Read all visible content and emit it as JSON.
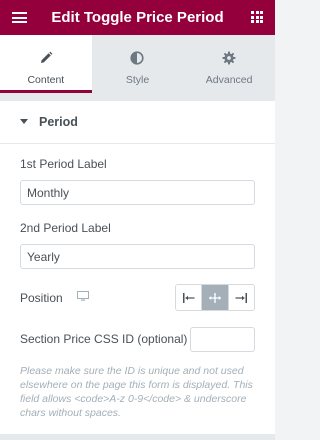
{
  "header": {
    "title": "Edit Toggle Price Period",
    "menu_icon": "hamburger-icon",
    "widgets_icon": "grid-icon",
    "background": "#93003c"
  },
  "tabs": [
    {
      "label": "Content",
      "icon": "pencil-icon",
      "active": true
    },
    {
      "label": "Style",
      "icon": "half-circle-icon",
      "active": false
    },
    {
      "label": "Advanced",
      "icon": "gear-icon",
      "active": false
    }
  ],
  "section": {
    "title": "Period",
    "expanded": true
  },
  "fields": {
    "first_label": {
      "label": "1st Period Label",
      "value": "Monthly"
    },
    "second_label": {
      "label": "2nd Period Label",
      "value": "Yearly"
    },
    "position": {
      "label": "Position",
      "device_icon": "desktop-icon",
      "options": [
        "left",
        "center",
        "right"
      ],
      "selected": "center"
    },
    "css_id": {
      "label": "Section Price CSS ID (optional)",
      "value": ""
    }
  },
  "help_text": "Please make sure the ID is unique and not used elsewhere on the page this form is displayed. This field allows <code>A-z 0-9</code> & underscore chars without spaces.",
  "colors": {
    "accent": "#93003c",
    "text": "#495157",
    "muted": "#a4afb7",
    "border": "#d5dadf",
    "panel_bg": "#e6e9ec"
  }
}
